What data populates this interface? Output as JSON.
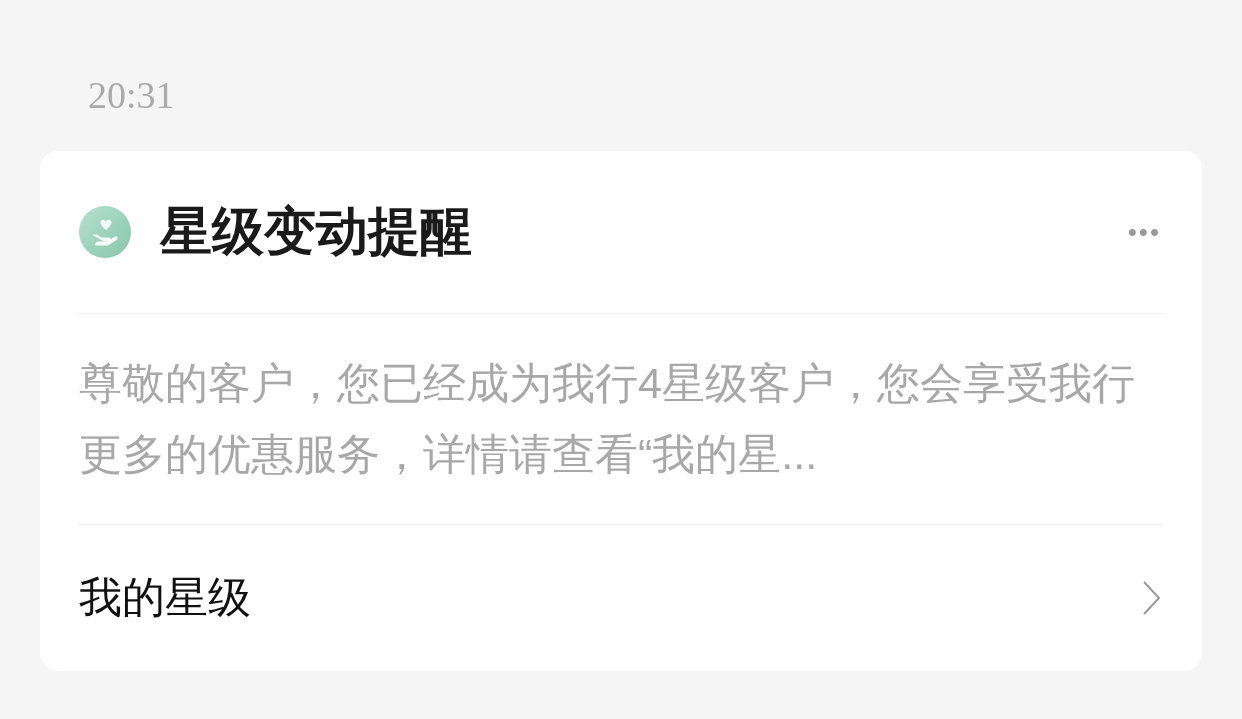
{
  "time": "20:31",
  "card": {
    "title": "星级变动提醒",
    "more": "•••",
    "message": "尊敬的客户，您已经成为我行4星级客户，您会享受我行更多的优惠服务，详情请查看“我的星...",
    "link": "我的星级"
  }
}
